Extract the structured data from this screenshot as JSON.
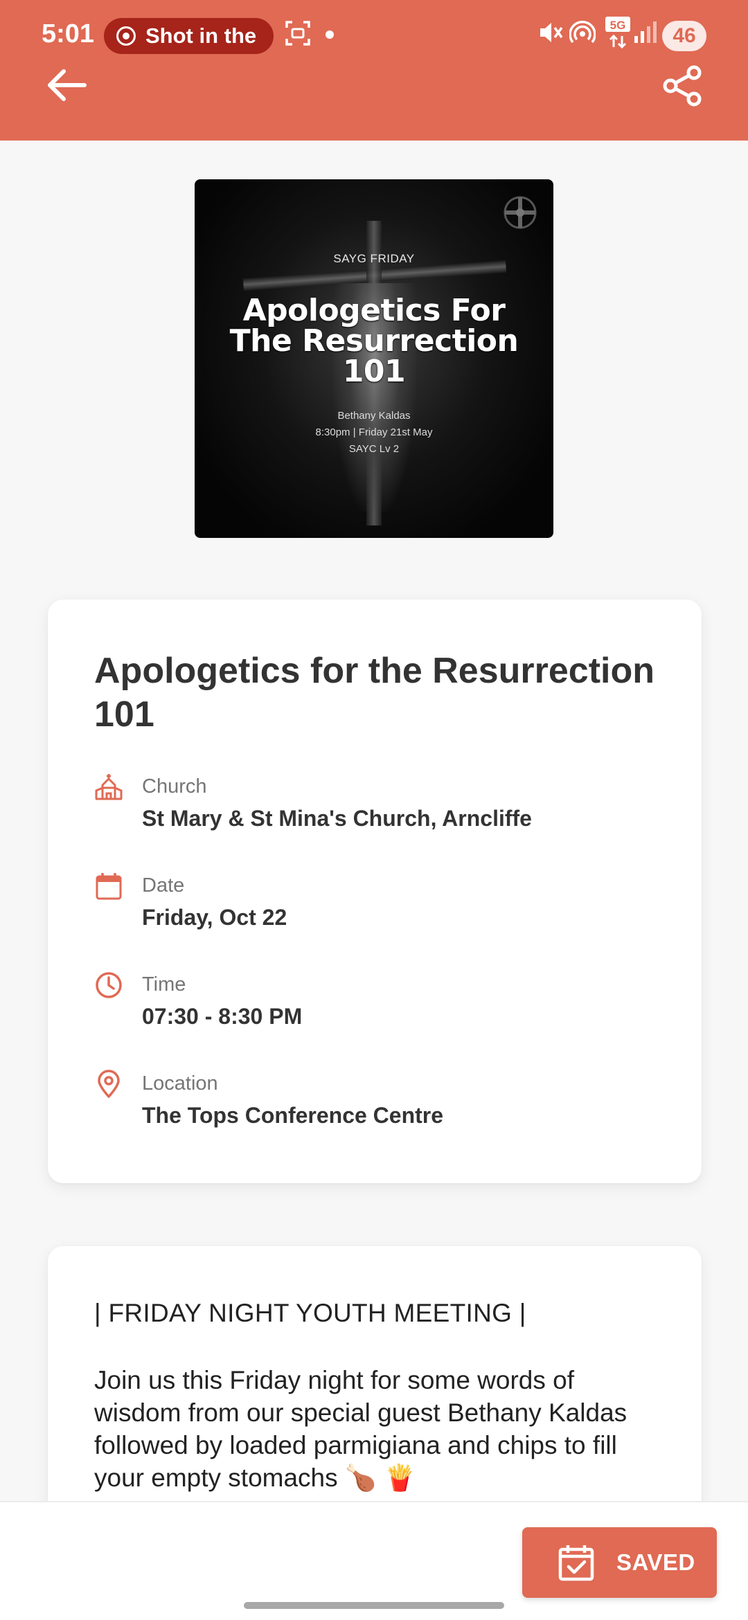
{
  "status_bar": {
    "time": "5:01",
    "recording_label": "Shot in the",
    "battery": "46",
    "icons": [
      "screenshot-icon",
      "mute-icon",
      "hotspot-icon",
      "5g-icon",
      "signal-icon",
      "battery-icon"
    ]
  },
  "header": {
    "back_icon": "arrow-left-icon",
    "share_icon": "share-icon"
  },
  "poster": {
    "kicker": "SAYG FRIDAY",
    "title_line1": "Apologetics For",
    "title_line2": "The Resurrection",
    "title_line3": "101",
    "speaker": "Bethany Kaldas",
    "when": "8:30pm | Friday 21st May",
    "where": "SAYC Lv 2"
  },
  "event": {
    "title": "Apologetics for the Resurrection 101",
    "details": {
      "church": {
        "label": "Church",
        "value": "St Mary & St Mina's Church, Arncliffe",
        "icon": "church-icon"
      },
      "date": {
        "label": "Date",
        "value": "Friday, Oct 22",
        "icon": "calendar-icon"
      },
      "time": {
        "label": "Time",
        "value": "07:30 - 8:30 PM",
        "icon": "clock-icon"
      },
      "location": {
        "label": "Location",
        "value": "The Tops Conference Centre",
        "icon": "location-pin-icon"
      }
    }
  },
  "description": {
    "heading": "| FRIDAY NIGHT YOUTH MEETING |",
    "body": "Join us this Friday night for some words of wisdom from our special guest Bethany Kaldas followed by loaded parmigiana and chips to fill your empty stomachs 🍗 🍟"
  },
  "actions": {
    "saved_label": "SAVED",
    "saved_icon": "calendar-check-icon"
  },
  "colors": {
    "accent": "#e06a54",
    "recording_pill": "#a6241a",
    "text_primary": "#333333",
    "text_secondary": "#757575",
    "background": "#f7f7f7"
  }
}
